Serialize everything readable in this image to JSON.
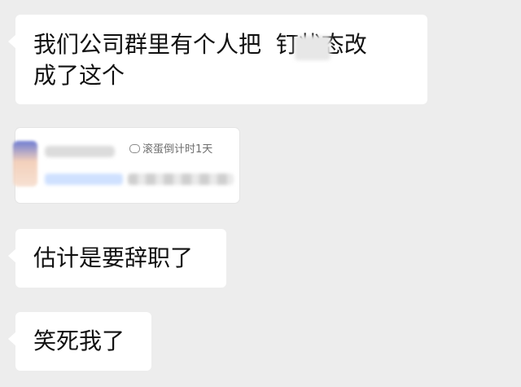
{
  "chat": {
    "messages": [
      {
        "text": "我们公司群里有个人把  钉状态改\n成了这个"
      },
      {
        "text": "估计是要辞职了"
      },
      {
        "text": "笑死我了"
      }
    ],
    "card": {
      "status_text": "滚蛋倒计时1天"
    }
  },
  "colors": {
    "background": "#ededed",
    "bubble": "#ffffff",
    "text": "#111111"
  }
}
